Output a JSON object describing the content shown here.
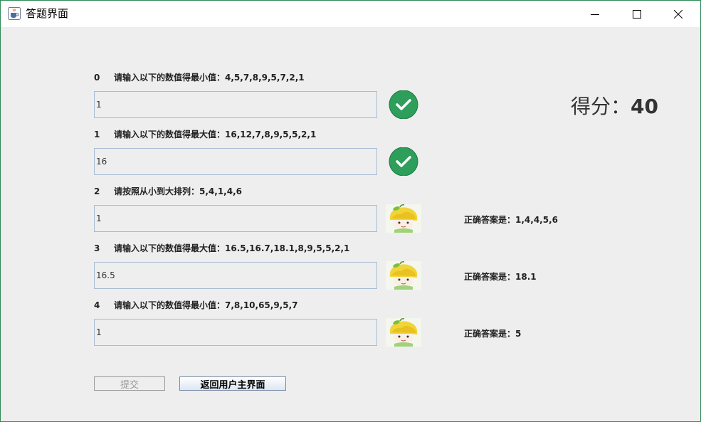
{
  "window": {
    "title": "答题界面",
    "icon": "java-cup-icon",
    "controls": [
      "minimize-icon",
      "maximize-icon",
      "close-icon"
    ]
  },
  "score": {
    "label": "得分：",
    "value": "40"
  },
  "questions": [
    {
      "number": "0",
      "prompt": "请输入以下的数值得最小值：4,5,7,8,9,5,7,2,1",
      "answer": "1",
      "result": "correct",
      "correct_answer_text": ""
    },
    {
      "number": "1",
      "prompt": "请输入以下的数值得最大值：16,12,7,8,9,5,5,2,1",
      "answer": "16",
      "result": "correct",
      "correct_answer_text": ""
    },
    {
      "number": "2",
      "prompt": "请按照从小到大排列：5,4,1,4,6",
      "answer": "1",
      "result": "wrong",
      "correct_answer_text": "正确答案是：1,4,4,5,6"
    },
    {
      "number": "3",
      "prompt": "请输入以下的数值得最大值：16.5,16.7,18.1,8,9,5,5,2,1",
      "answer": "16.5",
      "result": "wrong",
      "correct_answer_text": "正确答案是：18.1"
    },
    {
      "number": "4",
      "prompt": "请输入以下的数值得最小值：7,8,10,65,9,5,7",
      "answer": "1",
      "result": "wrong",
      "correct_answer_text": "正确答案是：5"
    }
  ],
  "buttons": {
    "submit_label": "提交",
    "return_label": "返回用户主界面"
  },
  "colors": {
    "correct_green": "#2e9e5b",
    "window_border": "#2e8b57",
    "panel_bg": "#eeeeee"
  }
}
